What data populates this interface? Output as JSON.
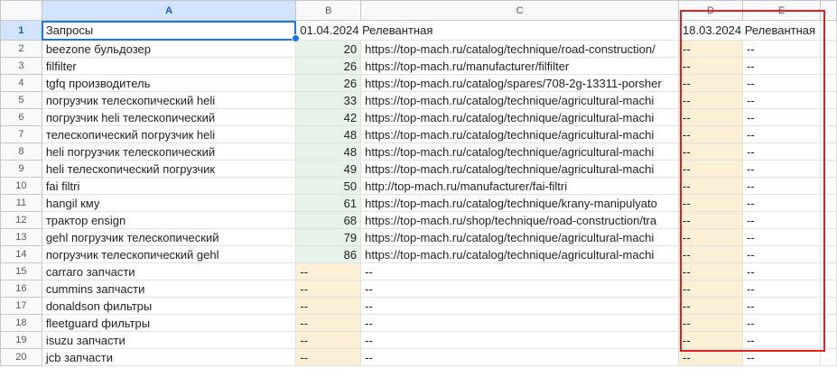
{
  "columns": [
    "A",
    "B",
    "C",
    "D",
    "E"
  ],
  "header_row": {
    "num": "1",
    "a": "Запросы",
    "b": "01.04.2024",
    "b2": "Релевантная",
    "d": "18.03.2024",
    "e": "Релевантная"
  },
  "rows": [
    {
      "num": "2",
      "a": "beezone бульдозер",
      "b": "20",
      "c": "https://top-mach.ru/catalog/technique/road-construction/",
      "d": "--",
      "e": "--"
    },
    {
      "num": "3",
      "a": "filfilter",
      "b": "26",
      "c": "https://top-mach.ru/manufacturer/filfilter",
      "d": "--",
      "e": "--"
    },
    {
      "num": "4",
      "a": "tgfq производитель",
      "b": "26",
      "c": "https://top-mach.ru/catalog/spares/708-2g-13311-porsher",
      "d": "--",
      "e": "--"
    },
    {
      "num": "5",
      "a": "погрузчик телескопический heli",
      "b": "33",
      "c": "https://top-mach.ru/catalog/technique/agricultural-machi",
      "d": "--",
      "e": "--"
    },
    {
      "num": "6",
      "a": "погрузчик heli телескопический",
      "b": "42",
      "c": "https://top-mach.ru/catalog/technique/agricultural-machi",
      "d": "--",
      "e": "--"
    },
    {
      "num": "7",
      "a": "телескопический погрузчик heli",
      "b": "48",
      "c": "https://top-mach.ru/catalog/technique/agricultural-machi",
      "d": "--",
      "e": "--"
    },
    {
      "num": "8",
      "a": "heli погрузчик телескопический",
      "b": "48",
      "c": "https://top-mach.ru/catalog/technique/agricultural-machi",
      "d": "--",
      "e": "--"
    },
    {
      "num": "9",
      "a": "heli телескопический погрузчик",
      "b": "49",
      "c": "https://top-mach.ru/catalog/technique/agricultural-machi",
      "d": "--",
      "e": "--"
    },
    {
      "num": "10",
      "a": "fai filtri",
      "b": "50",
      "c": "http://top-mach.ru/manufacturer/fai-filtri",
      "d": "--",
      "e": "--"
    },
    {
      "num": "11",
      "a": "hangil кму",
      "b": "61",
      "c": "https://top-mach.ru/catalog/technique/krany-manipulyato",
      "d": "--",
      "e": "--"
    },
    {
      "num": "12",
      "a": "трактор ensign",
      "b": "68",
      "c": "https://top-mach.ru/shop/technique/road-construction/tra",
      "d": "--",
      "e": "--"
    },
    {
      "num": "13",
      "a": "gehl погрузчик телескопический",
      "b": "79",
      "c": "https://top-mach.ru/catalog/technique/agricultural-machi",
      "d": "--",
      "e": "--"
    },
    {
      "num": "14",
      "a": "погрузчик телескопический gehl",
      "b": "86",
      "c": "https://top-mach.ru/catalog/technique/agricultural-machi",
      "d": "--",
      "e": "--"
    },
    {
      "num": "15",
      "a": "carraro запчасти",
      "b": "--",
      "c": "--",
      "d": "--",
      "e": "--"
    },
    {
      "num": "16",
      "a": "cummins запчасти",
      "b": "--",
      "c": "--",
      "d": "--",
      "e": "--"
    },
    {
      "num": "17",
      "a": "donaldson фильтры",
      "b": "--",
      "c": "--",
      "d": "--",
      "e": "--"
    },
    {
      "num": "18",
      "a": "fleetguard фильтры",
      "b": "--",
      "c": "--",
      "d": "--",
      "e": "--"
    },
    {
      "num": "19",
      "a": "isuzu запчасти",
      "b": "--",
      "c": "--",
      "d": "--",
      "e": "--"
    },
    {
      "num": "20",
      "a": "jcb запчасти",
      "b": "--",
      "c": "--",
      "d": "--",
      "e": "--"
    }
  ],
  "colors": {
    "green_fill": "#e6f4ea",
    "tan_fill": "#fbefd5",
    "selection": "#1a73e8",
    "annotation_box": "#e02020"
  }
}
